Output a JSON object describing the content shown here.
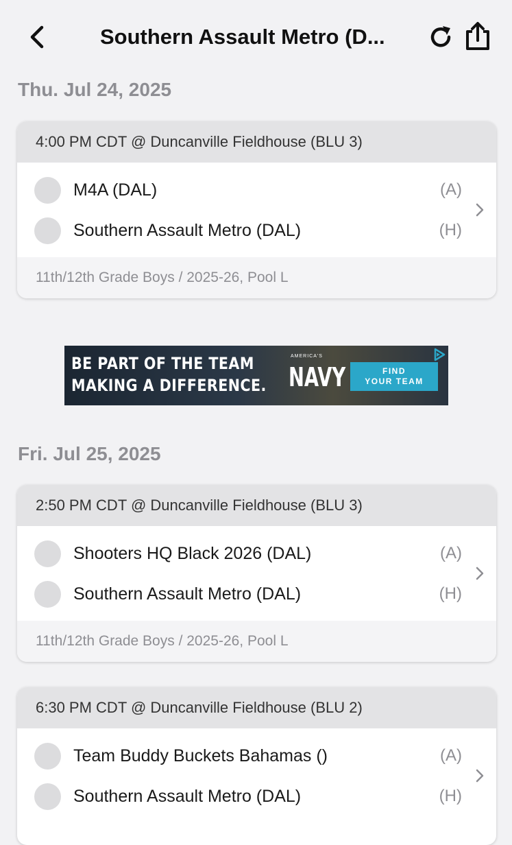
{
  "header": {
    "title": "Southern Assault Metro (D...",
    "icons": {
      "back": "chevron-left-icon",
      "refresh": "refresh-icon",
      "share": "share-icon"
    }
  },
  "days": [
    {
      "date": "Thu. Jul 24, 2025",
      "games": [
        {
          "time_location": "4:00 PM CDT @ Duncanville Fieldhouse (BLU 3)",
          "away": {
            "name": "M4A (DAL)",
            "side": "(A)"
          },
          "home": {
            "name": "Southern Assault Metro (DAL)",
            "side": "(H)"
          },
          "division": "11th/12th Grade Boys / 2025-26, Pool L"
        }
      ]
    },
    {
      "date": "Fri. Jul 25, 2025",
      "games": [
        {
          "time_location": "2:50 PM CDT @ Duncanville Fieldhouse (BLU 3)",
          "away": {
            "name": "Shooters HQ Black 2026 (DAL)",
            "side": "(A)"
          },
          "home": {
            "name": "Southern Assault Metro (DAL)",
            "side": "(H)"
          },
          "division": "11th/12th Grade Boys / 2025-26, Pool L"
        },
        {
          "time_location": "6:30 PM CDT @ Duncanville Fieldhouse (BLU 2)",
          "away": {
            "name": "Team Buddy Buckets Bahamas ()",
            "side": "(A)"
          },
          "home": {
            "name": "Southern Assault Metro (DAL)",
            "side": "(H)"
          }
        }
      ]
    }
  ],
  "ad": {
    "line1": "BE PART OF THE TEAM",
    "line2": "MAKING A DIFFERENCE.",
    "brand_small": "AMERICA'S",
    "brand": "NAVY",
    "cta_line1": "FIND",
    "cta_line2": "YOUR TEAM",
    "badge_icon": "adchoices-icon",
    "cta_color": "#2ba7c9"
  },
  "colors": {
    "background": "#f2f2f4",
    "card_header": "#e3e3e5",
    "muted_text": "#8e8e93"
  }
}
